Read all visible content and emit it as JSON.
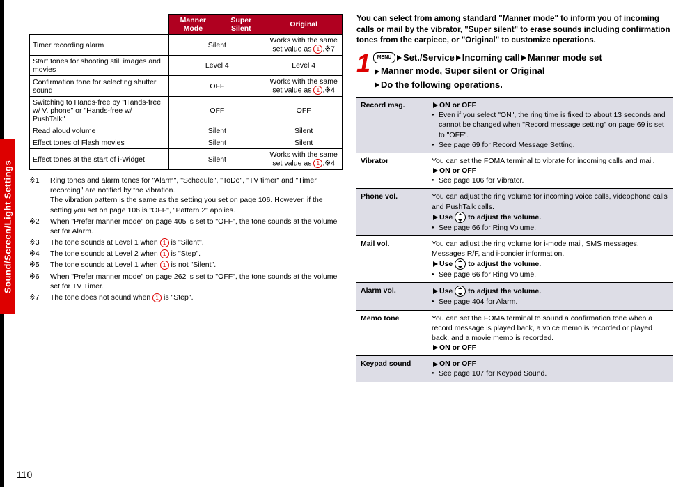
{
  "sideTab": "Sound/Screen/Light Settings",
  "pageNum": "110",
  "leftTable": {
    "headers": [
      "",
      "Manner Mode",
      "Super Silent",
      "Original"
    ],
    "rows": [
      {
        "label": "Timer recording alarm",
        "manner": "Silent",
        "original": "Works with the same set value as CIRC1.※7",
        "mergedManner": false
      },
      {
        "label": "Start tones for shooting still images and movies",
        "manner": "Level 4",
        "original": "Level 4",
        "mergedManner": false
      },
      {
        "label": "Confirmation tone for selecting shutter sound",
        "manner": "OFF",
        "original": "Works with the same set value as CIRC1.※4",
        "mergedManner": false
      },
      {
        "label": "Switching to Hands-free by \"Hands-free w/ V. phone\" or \"Hands-free w/ PushTalk\"",
        "manner": "OFF",
        "original": "OFF",
        "mergedManner": false
      },
      {
        "label": "Read aloud volume",
        "manner": "Silent",
        "original": "Silent",
        "mergedManner": false
      },
      {
        "label": "Effect tones of Flash movies",
        "manner": "Silent",
        "original": "Silent",
        "mergedManner": false
      },
      {
        "label": "Effect tones at the start of i-Widget",
        "manner": "Silent",
        "original": "Works with the same set value as CIRC1.※4",
        "mergedManner": false
      }
    ]
  },
  "notes": [
    {
      "tag": "※1",
      "text": "Ring tones and alarm tones for \"Alarm\", \"Schedule\", \"ToDo\", \"TV timer\" and \"Timer recording\" are notified by the vibration.",
      "extra": "The vibration pattern is the same as the setting you set on page 106. However, if the setting you set on page 106 is \"OFF\", \"Pattern 2\" applies."
    },
    {
      "tag": "※2",
      "text": "When \"Prefer manner mode\" on page 405 is set to \"OFF\", the tone sounds at the volume set for Alarm."
    },
    {
      "tag": "※3",
      "text": "The tone sounds at Level 1 when CIRC1 is \"Silent\"."
    },
    {
      "tag": "※4",
      "text": "The tone sounds at Level 2 when CIRC1 is \"Step\"."
    },
    {
      "tag": "※5",
      "text": "The tone sounds at Level 1 when CIRC1 is not \"Silent\"."
    },
    {
      "tag": "※6",
      "text": "When \"Prefer manner mode\" on page 262 is set to \"OFF\", the tone sounds at the volume set for TV Timer."
    },
    {
      "tag": "※7",
      "text": "The tone does not sound when CIRC1 is \"Step\"."
    }
  ],
  "intro": "You can select from among standard \"Manner mode\" to inform you of incoming calls or mail by the vibrator, \"Super silent\" to erase sounds including confirmation tones from the earpiece, or \"Original\" to customize operations.",
  "step": {
    "num": "1",
    "menu": "MENU",
    "path1": "Set./Service",
    "path2": "Incoming call",
    "path3": "Manner mode set",
    "line2": "Manner mode, Super silent or Original",
    "line3": "Do the following operations."
  },
  "settings": [
    {
      "key": "Record msg.",
      "lines": [
        {
          "type": "arrow",
          "bold": "ON or OFF"
        },
        {
          "type": "bullet",
          "text": "Even if you select \"ON\", the ring time is fixed to about 13 seconds and cannot be changed when \"Record message setting\" on page 69 is set to \"OFF\"."
        },
        {
          "type": "bullet",
          "text": "See page 69 for Record Message Setting."
        }
      ]
    },
    {
      "key": "Vibrator",
      "lines": [
        {
          "type": "plain",
          "text": "You can set the FOMA terminal to vibrate for incoming calls and mail."
        },
        {
          "type": "arrow",
          "bold": "ON or OFF"
        },
        {
          "type": "bullet",
          "text": "See page 106 for Vibrator."
        }
      ]
    },
    {
      "key": "Phone vol.",
      "lines": [
        {
          "type": "plain",
          "text": "You can adjust the ring volume for incoming voice calls, videophone calls and PushTalk calls."
        },
        {
          "type": "arrow",
          "bold": "Use DPAD to adjust the volume."
        },
        {
          "type": "bullet",
          "text": "See page 66 for Ring Volume."
        }
      ]
    },
    {
      "key": "Mail vol.",
      "lines": [
        {
          "type": "plain",
          "text": "You can adjust the ring volume for i-mode mail, SMS messages, Messages R/F, and i-concier information."
        },
        {
          "type": "arrow",
          "bold": "Use DPAD to adjust the volume."
        },
        {
          "type": "bullet",
          "text": "See page 66 for Ring Volume."
        }
      ]
    },
    {
      "key": "Alarm vol.",
      "lines": [
        {
          "type": "arrow",
          "bold": "Use DPAD to adjust the volume."
        },
        {
          "type": "bullet",
          "text": "See page 404 for Alarm."
        }
      ]
    },
    {
      "key": "Memo tone",
      "lines": [
        {
          "type": "plain",
          "text": "You can set the FOMA terminal to sound a confirmation tone when a record message is played back, a voice memo is recorded or played back, and a movie memo is recorded."
        },
        {
          "type": "arrow",
          "bold": "ON or OFF"
        }
      ]
    },
    {
      "key": "Keypad sound",
      "lines": [
        {
          "type": "arrow",
          "bold": "ON or OFF"
        },
        {
          "type": "bullet",
          "text": "See page 107 for Keypad Sound."
        }
      ]
    }
  ]
}
